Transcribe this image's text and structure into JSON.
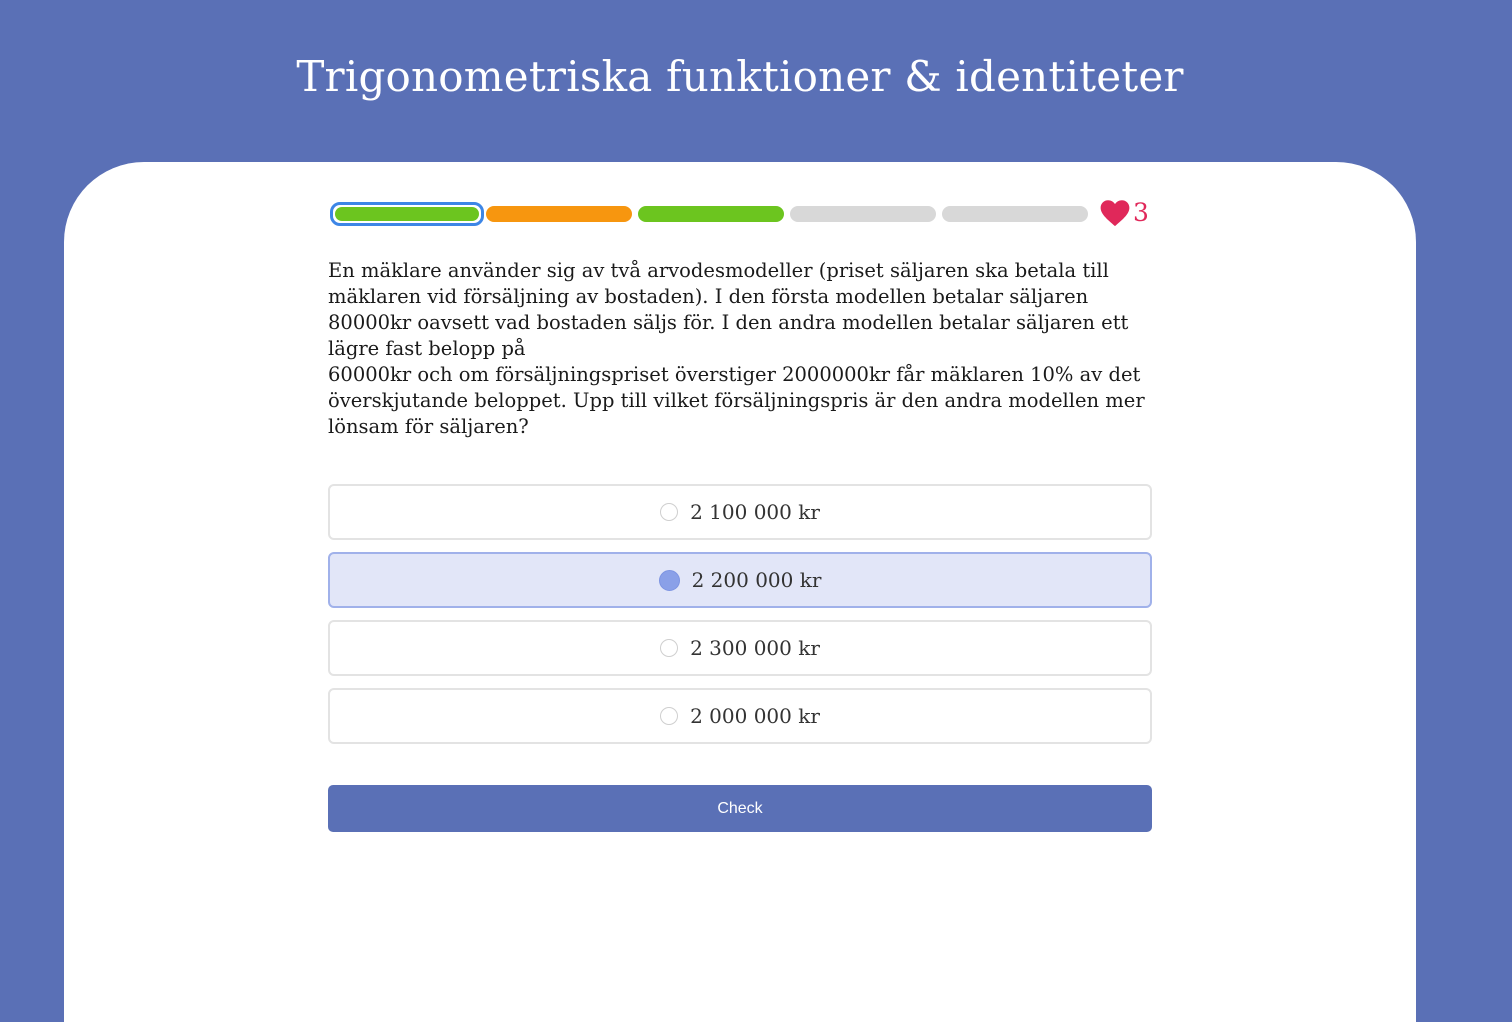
{
  "header": {
    "title": "Trigonometriska funktioner & identiteter"
  },
  "progress": {
    "segments": [
      {
        "state": "correct-current",
        "color": "#6cc51f"
      },
      {
        "state": "partial",
        "color": "#f7960f"
      },
      {
        "state": "correct",
        "color": "#6cc51f"
      },
      {
        "state": "pending",
        "color": "#d8d8d8"
      },
      {
        "state": "pending",
        "color": "#d8d8d8"
      }
    ],
    "current_outline_color": "#3d86e6"
  },
  "lives": {
    "icon": "heart-icon",
    "count": "3",
    "color": "#e0285a"
  },
  "question": {
    "text": "En mäklare använder sig av två arvodesmodeller (priset säljaren ska betala till mäklaren vid försäljning av bostaden). I den första modellen betalar säljaren\n80000kr oavsett vad bostaden säljs för. I den andra modellen betalar säljaren ett lägre fast belopp på\n60000kr och om försäljningspriset överstiger 2000000kr får mäklaren 10% av det överskjutande beloppet. Upp till vilket försäljningspris är den andra modellen mer lönsam för säljaren?"
  },
  "options": [
    {
      "label": "2 100 000 kr",
      "selected": false
    },
    {
      "label": "2 200 000 kr",
      "selected": true
    },
    {
      "label": "2 300 000 kr",
      "selected": false
    },
    {
      "label": "2 000 000 kr",
      "selected": false
    }
  ],
  "actions": {
    "check_label": "Check"
  },
  "colors": {
    "background": "#5a70b6",
    "card": "#ffffff",
    "selected_option": "#e2e6f8",
    "button": "#5a70b6"
  }
}
